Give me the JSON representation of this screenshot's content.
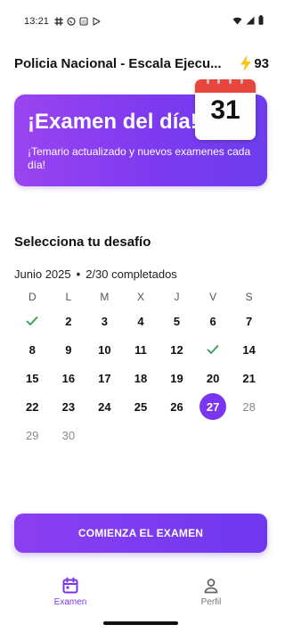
{
  "status_bar": {
    "time": "13:21",
    "notification_icons": [
      "slack-icon",
      "whatsapp-icon",
      "calendar-31-icon",
      "play-store-icon"
    ],
    "right_icons": [
      "wifi-icon",
      "signal-icon",
      "battery-icon"
    ]
  },
  "header": {
    "title": "Policia Nacional - Escala Ejecu...",
    "streak_count": "93",
    "streak_icon": "lightning-icon",
    "streak_color": "#f5c518"
  },
  "banner": {
    "title": "¡Examen del día!",
    "subtitle": "¡Temario actualizado y nuevos examenes cada día!",
    "calendar_day": "31",
    "gradient_start": "#9b44f0",
    "gradient_end": "#6d3ded"
  },
  "challenge": {
    "section_title": "Selecciona tu desafío",
    "month": "Junio 2025",
    "separator": "•",
    "progress": "2/30 completados",
    "weekdays": [
      "D",
      "L",
      "M",
      "X",
      "J",
      "V",
      "S"
    ],
    "weeks": [
      [
        {
          "day": "",
          "state": "done"
        },
        {
          "day": "2",
          "state": "past"
        },
        {
          "day": "3",
          "state": "past"
        },
        {
          "day": "4",
          "state": "past"
        },
        {
          "day": "5",
          "state": "past"
        },
        {
          "day": "6",
          "state": "past"
        },
        {
          "day": "7",
          "state": "past"
        }
      ],
      [
        {
          "day": "8",
          "state": "past"
        },
        {
          "day": "9",
          "state": "past"
        },
        {
          "day": "10",
          "state": "past"
        },
        {
          "day": "11",
          "state": "past"
        },
        {
          "day": "12",
          "state": "past"
        },
        {
          "day": "",
          "state": "done"
        },
        {
          "day": "14",
          "state": "past"
        }
      ],
      [
        {
          "day": "15",
          "state": "past"
        },
        {
          "day": "16",
          "state": "past"
        },
        {
          "day": "17",
          "state": "past"
        },
        {
          "day": "18",
          "state": "past"
        },
        {
          "day": "19",
          "state": "past"
        },
        {
          "day": "20",
          "state": "past"
        },
        {
          "day": "21",
          "state": "past"
        }
      ],
      [
        {
          "day": "22",
          "state": "past"
        },
        {
          "day": "23",
          "state": "past"
        },
        {
          "day": "24",
          "state": "past"
        },
        {
          "day": "25",
          "state": "past"
        },
        {
          "day": "26",
          "state": "past"
        },
        {
          "day": "27",
          "state": "today"
        },
        {
          "day": "28",
          "state": "future"
        }
      ],
      [
        {
          "day": "29",
          "state": "future"
        },
        {
          "day": "30",
          "state": "future"
        }
      ]
    ],
    "check_color": "#2e9e4f",
    "accent_color": "#7a35f0"
  },
  "start_button": {
    "label": "COMIENZA EL EXAMEN"
  },
  "bottom_nav": {
    "items": [
      {
        "label": "Examen",
        "icon": "calendar-icon",
        "active": true
      },
      {
        "label": "Perfil",
        "icon": "person-icon",
        "active": false
      }
    ]
  }
}
